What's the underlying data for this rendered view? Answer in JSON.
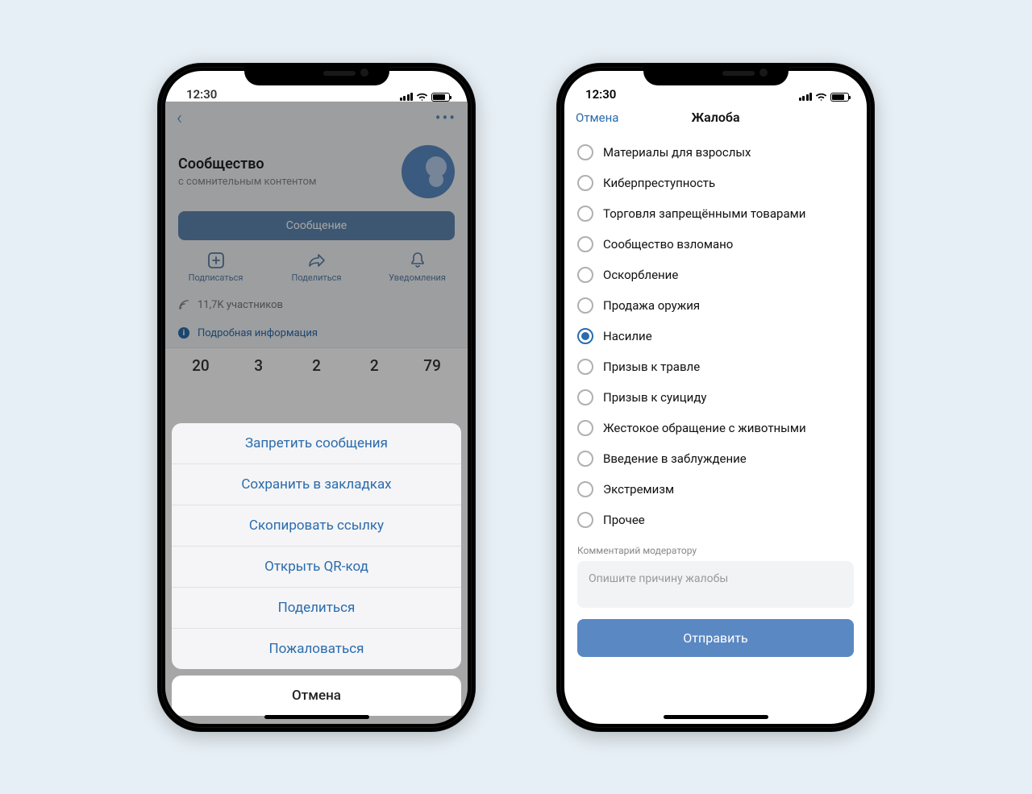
{
  "status": {
    "time": "12:30"
  },
  "left": {
    "nav": {
      "back": "‹",
      "more": "•••"
    },
    "community": {
      "name": "Сообщество",
      "subtitle": "с сомнительным контентом"
    },
    "message_btn": "Сообщение",
    "actions": [
      {
        "label": "Подписаться"
      },
      {
        "label": "Поделиться"
      },
      {
        "label": "Уведомления"
      }
    ],
    "followers": "11,7K участников",
    "detailed_info": "Подробная информация",
    "stats": [
      "20",
      "3",
      "2",
      "2",
      "79"
    ],
    "sheet": [
      "Запретить сообщения",
      "Сохранить в закладках",
      "Скопировать ссылку",
      "Открыть QR-код",
      "Поделиться",
      "Пожаловаться"
    ],
    "cancel": "Отмена"
  },
  "right": {
    "nav": {
      "cancel": "Отмена",
      "title": "Жалоба"
    },
    "options": [
      {
        "label": "Материалы для взрослых",
        "checked": false
      },
      {
        "label": "Киберпреступность",
        "checked": false
      },
      {
        "label": "Торговля запрещёнными товарами",
        "checked": false
      },
      {
        "label": "Сообщество взломано",
        "checked": false
      },
      {
        "label": "Оскорбление",
        "checked": false
      },
      {
        "label": "Продажа оружия",
        "checked": false
      },
      {
        "label": "Насилие",
        "checked": true
      },
      {
        "label": "Призыв к травле",
        "checked": false
      },
      {
        "label": "Призыв к суициду",
        "checked": false
      },
      {
        "label": "Жестокое обращение с животными",
        "checked": false
      },
      {
        "label": "Введение в заблуждение",
        "checked": false
      },
      {
        "label": "Экстремизм",
        "checked": false
      },
      {
        "label": "Прочее",
        "checked": false
      }
    ],
    "comment_label": "Комментарий модератору",
    "comment_placeholder": "Опишите причину жалобы",
    "submit": "Отправить"
  }
}
